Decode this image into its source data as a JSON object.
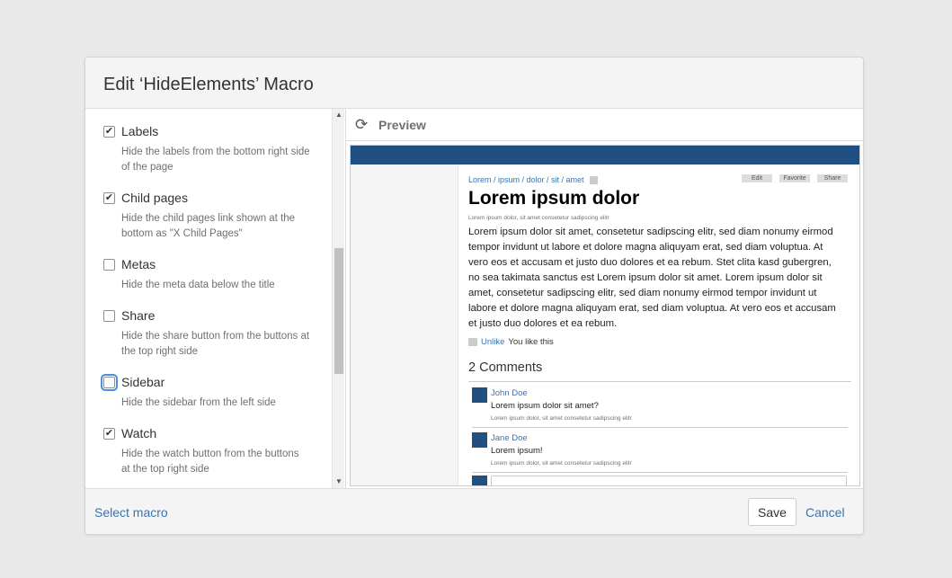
{
  "dialog": {
    "title": "Edit ‘HideElements’ Macro"
  },
  "options": [
    {
      "label": "Labels",
      "checked": true,
      "description": "Hide the labels from the bottom right side of the page"
    },
    {
      "label": "Child pages",
      "checked": true,
      "description": "Hide the child pages link shown at the bottom as \"X Child Pages\""
    },
    {
      "label": "Metas",
      "checked": false,
      "description": "Hide the meta data below the title"
    },
    {
      "label": "Share",
      "checked": false,
      "description": "Hide the share button from the buttons at the top right side"
    },
    {
      "label": "Sidebar",
      "checked": false,
      "description": "Hide the sidebar from the left side"
    },
    {
      "label": "Watch",
      "checked": true,
      "description": "Hide the watch button from the buttons at the top right side"
    }
  ],
  "preview": {
    "title": "Preview",
    "breadcrumb": "Lorem / ipsum / dolor / sit / amet",
    "buttons": {
      "edit": "Edit",
      "favorite": "Favorite",
      "share": "Share"
    },
    "page_title": "Lorem ipsum dolor",
    "meta": "Lorem ipsum dolor, sit amet consetetur sadipscing elitr",
    "body": "Lorem ipsum dolor sit amet, consetetur sadipscing elitr, sed diam nonumy eirmod tempor invidunt ut labore et dolore magna aliquyam erat, sed diam voluptua. At vero eos et accusam et justo duo dolores et ea rebum. Stet clita kasd gubergren, no sea takimata sanctus est Lorem ipsum dolor sit amet. Lorem ipsum dolor sit amet, consetetur sadipscing elitr, sed diam nonumy eirmod tempor invidunt ut labore et dolore magna aliquyam erat, sed diam voluptua. At vero eos et accusam et justo duo dolores et ea rebum.",
    "unlike": "Unlike",
    "you_like": "You like this",
    "comments_heading": "2 Comments",
    "comments": [
      {
        "author": "John Doe",
        "text": "Lorem ipsum dolor sit amet?",
        "meta": "Lorem ipsum dolor, sit amet consetetur sadipscing elitr"
      },
      {
        "author": "Jane Doe",
        "text": "Lorem ipsum!",
        "meta": "Lorem ipsum dolor, sit amet consetetur sadipscing elitr"
      }
    ]
  },
  "footer": {
    "select_macro": "Select macro",
    "save": "Save",
    "cancel": "Cancel"
  },
  "colors": {
    "brand": "#205081",
    "link": "#3b73af"
  },
  "icons": {
    "refresh": "refresh-icon",
    "check": "checkmark-icon"
  }
}
